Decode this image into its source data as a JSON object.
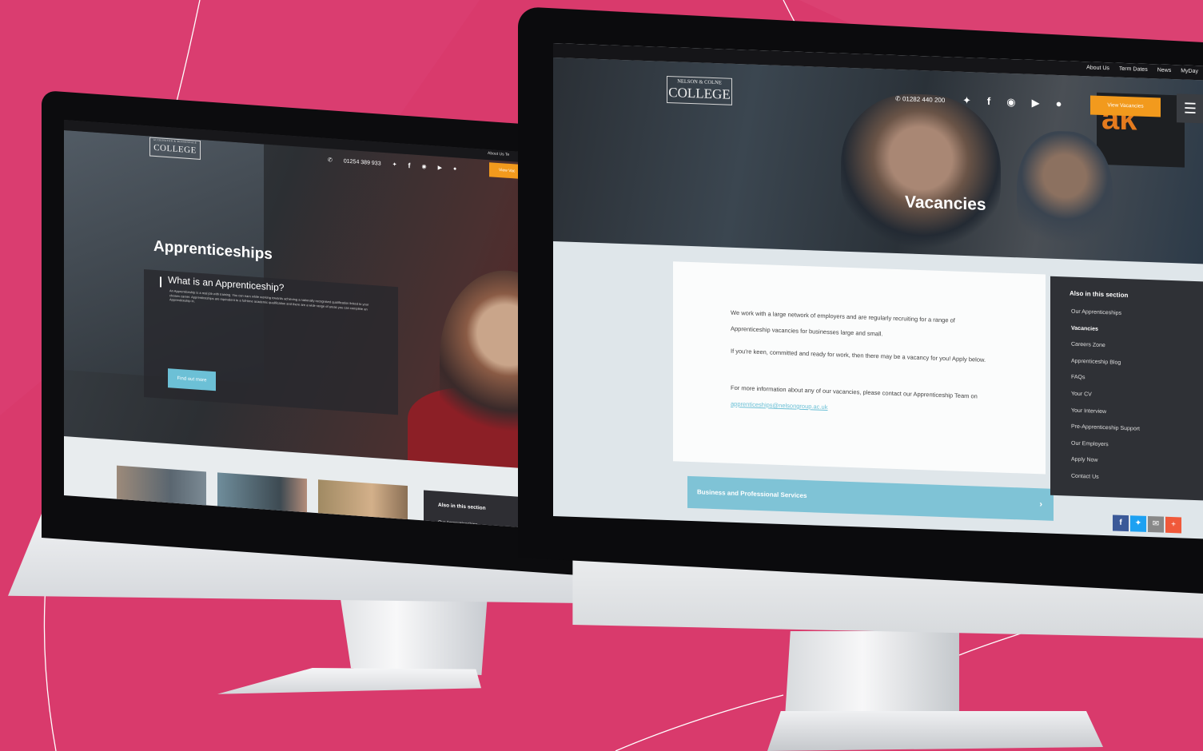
{
  "left_site": {
    "logo_line1": "ACCRINGTON & ROSSENDALE",
    "logo_line2": "COLLEGE",
    "phone": "01254 389 933",
    "top_link": "About Us",
    "top_link_2": "Te",
    "cta": "View Vac",
    "hero_title": "Apprenticeships",
    "card_title": "What is an Apprenticeship?",
    "card_text": "An Apprenticeship is a real job with training. You can earn while working towards achieving a nationally recognised qualification linked to your chosen career. Apprenticeships are equivalent to a full-time academic qualification and there are a wide range of areas you can complete an Apprenticeship in.",
    "find_out": "Find out more",
    "sidebar_heading": "Also in this section",
    "sidebar_first": "Our Apprenticeships"
  },
  "right_site": {
    "top_links": [
      "About Us",
      "Term Dates",
      "News",
      "MyDay"
    ],
    "logo_line1": "NELSON & COLNE",
    "logo_line2": "COLLEGE",
    "phone": "01282 440 200",
    "cta": "View Vacancies",
    "hero_title": "Vacancies",
    "paragraphs": [
      "We work with a large network of employers and are regularly recruiting for a range of Apprenticeship vacancies for businesses large and small.",
      "If you're keen, committed and ready for work, then there may be a vacancy for you! Apply below.",
      "For more information about any of our vacancies, please contact our Apprenticeship Team on"
    ],
    "email": "apprenticeships@nelsongroup.ac.uk",
    "accordion": "Business and Professional Services",
    "sidebar_heading": "Also in this section",
    "sidebar_items": [
      "Our Apprenticeships",
      "Vacancies",
      "Careers Zone",
      "Apprenticeship Blog",
      "FAQs",
      "Your CV",
      "Your Interview",
      "Pre-Apprenticeship Support",
      "Our Employers",
      "Apply Now",
      "Contact Us"
    ],
    "active_item": "Vacancies"
  },
  "colors": {
    "background": "#d93a6c",
    "accent_orange": "#f29a1d",
    "accent_teal": "#6cc0d6"
  }
}
